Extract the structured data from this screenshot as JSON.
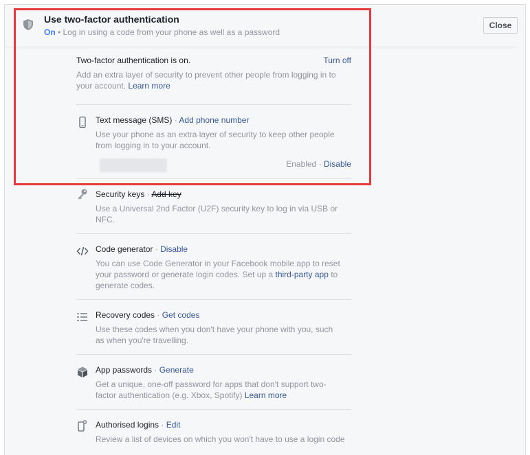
{
  "header": {
    "title": "Use two-factor authentication",
    "status": "On",
    "subtitle_rest": " • Log in using a code from your phone as well as a password",
    "close_label": "Close"
  },
  "status": {
    "line": "Two-factor authentication is on.",
    "turn_off": "Turn off",
    "desc": "Add an extra layer of security to prevent other people from logging in to your account.",
    "learn_more": "Learn more"
  },
  "methods": {
    "sms": {
      "title": "Text message (SMS)",
      "action": "Add phone number",
      "desc": "Use your phone as an extra layer of security to keep other people from logging in to your account.",
      "enabled": "Enabled",
      "disable": "Disable"
    },
    "security_keys": {
      "title": "Security keys",
      "action": "Add key",
      "desc": "Use a Universal 2nd Factor (U2F) security key to log in via USB or NFC."
    },
    "code_generator": {
      "title": "Code generator",
      "action": "Disable",
      "desc_a": "You can use Code Generator in your Facebook mobile app to reset your password or generate login codes. Set up a ",
      "link": "third-party app",
      "desc_b": " to generate codes."
    },
    "recovery_codes": {
      "title": "Recovery codes",
      "action": "Get codes",
      "desc": "Use these codes when you don't have your phone with you, such as when you're travelling."
    },
    "app_passwords": {
      "title": "App passwords",
      "action": "Generate",
      "desc": "Get a unique, one-off password for apps that don't support two-factor authentication (e.g. Xbox, Spotify) ",
      "learn_more": "Learn more"
    },
    "authorised_logins": {
      "title": "Authorised logins",
      "action": "Edit",
      "desc": "Review a list of devices on which you won't have to use a login code"
    }
  },
  "dot": " · ",
  "icons": {
    "shield": "shield-icon",
    "phone": "phone-icon",
    "key": "key-icon",
    "code": "code-icon",
    "list": "list-icon",
    "cube": "cube-icon",
    "device": "device-icon"
  },
  "colors": {
    "link": "#365899",
    "on": "#4080ff",
    "highlight": "#e8383d"
  }
}
